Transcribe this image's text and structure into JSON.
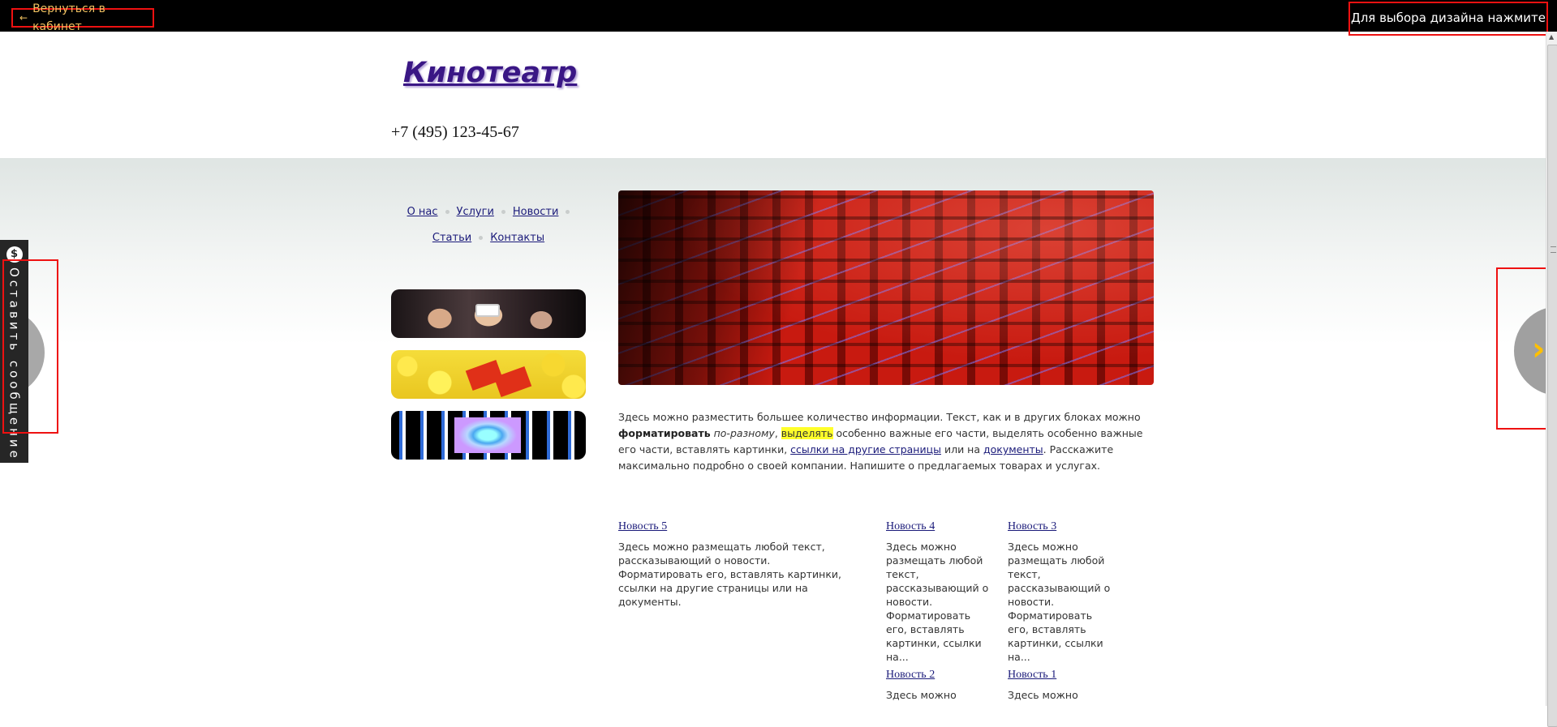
{
  "topbar": {
    "back_label": "Вернуться в кабинет",
    "design_hint": "Для выбора дизайна нажмите Enter"
  },
  "site": {
    "logo": "Кинотеатр",
    "phone": "+7 (495) 123-45-67"
  },
  "nav": {
    "items": [
      "О нас",
      "Услуги",
      "Новости",
      "Статьи",
      "Контакты"
    ]
  },
  "intro": {
    "t1": "Здесь можно разместить большее количество информации. Текст, как и в других блоках можно ",
    "bold": "форматировать",
    "t2": " ",
    "italic": "по-разному",
    "t3": ", ",
    "highlight": "выделять",
    "t4": " особенно важные его части, выделять особенно важные его части, вставлять картинки, ",
    "link1": "ссылки на другие страницы",
    "t5": " или на ",
    "link2": "документы",
    "t6": ". Расскажите максимально подробно о своей компании. Напишите о предлагаемых товарах и услугах."
  },
  "news": [
    {
      "title": "Новость 5",
      "text": "Здесь можно размещать любой текст, рассказывающий о новости. Форматировать его, вставлять картинки, ссылки на другие страницы или на документы."
    },
    {
      "title": "Новость 4",
      "text": "Здесь можно размещать любой текст, рассказывающий о новости. Форматировать его, вставлять картинки, ссылки на..."
    },
    {
      "title": "Новость 3",
      "text": "Здесь можно размещать любой текст, рассказывающий о новости. Форматировать его, вставлять картинки, ссылки на..."
    },
    {
      "title": "Новость 2",
      "text": "Здесь можно"
    },
    {
      "title": "Новость 1",
      "text": "Здесь можно"
    }
  ],
  "feedback": {
    "label": "Оставить сообщение",
    "icon": "$"
  },
  "colors": {
    "highlight_box": "#ee1111",
    "link": "#1b1b7a",
    "logo": "#3a1785",
    "arrow": "#ffc000"
  }
}
